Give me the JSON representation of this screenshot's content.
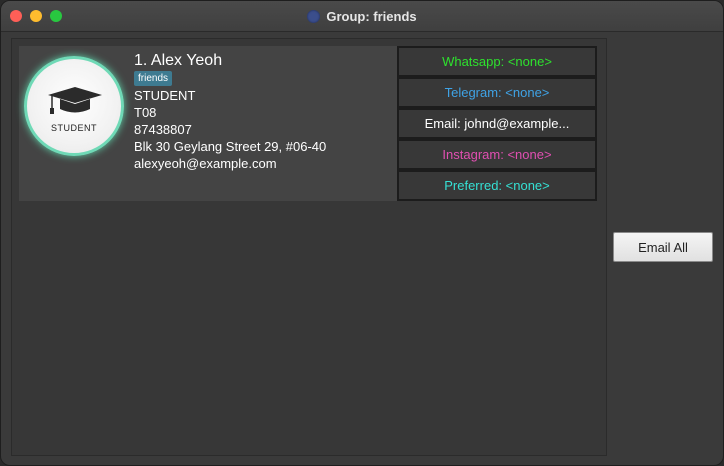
{
  "window": {
    "title": "Group: friends"
  },
  "person": {
    "index_name": "1.  Alex Yeoh",
    "tag": "friends",
    "avatar_label": "STUDENT",
    "role": "STUDENT",
    "tutorial": "T08",
    "phone": "87438807",
    "address": "Blk 30 Geylang Street 29, #06-40",
    "email": "alexyeoh@example.com"
  },
  "contacts": {
    "whatsapp": "Whatsapp: <none>",
    "telegram": "Telegram: <none>",
    "email": "Email: johnd@example...",
    "instagram": "Instagram: <none>",
    "preferred": "Preferred: <none>"
  },
  "colors": {
    "whatsapp": "#2ee12e",
    "telegram": "#3fa3e6",
    "email": "#ffffff",
    "instagram": "#e04fb1",
    "preferred": "#35e0d4",
    "avatar_ring": "#6fd9b6",
    "tag_bg": "#3e7b91"
  },
  "actions": {
    "email_all": "Email All"
  }
}
